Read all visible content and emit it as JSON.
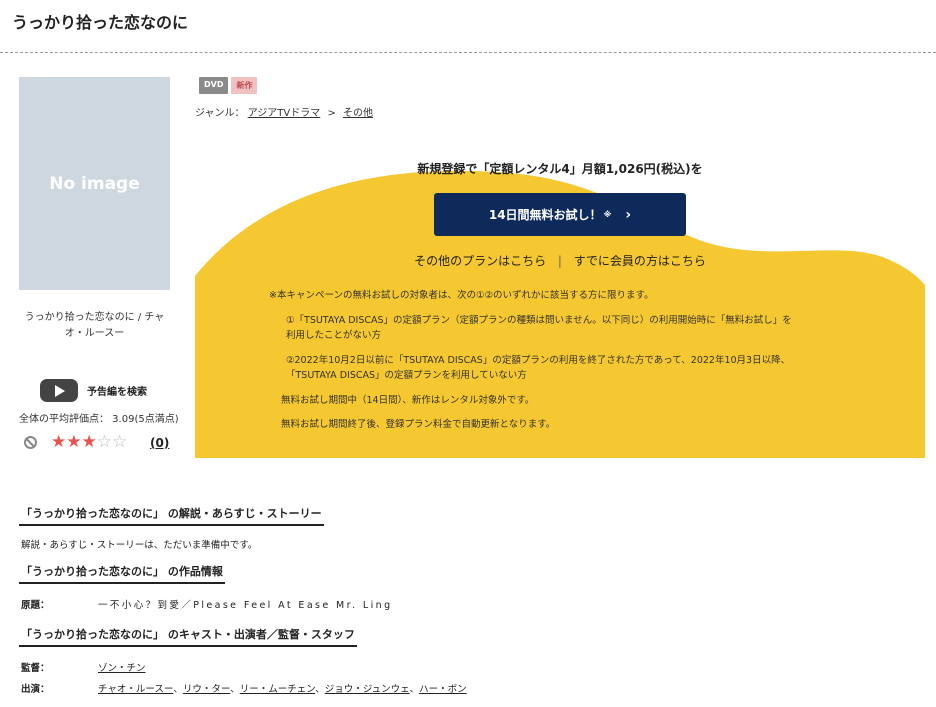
{
  "page": {
    "title": "うっかり拾った恋なのに"
  },
  "poster": {
    "placeholder": "No image",
    "caption": "うっかり拾った恋なのに / チャオ・ルースー"
  },
  "trailer": {
    "label": "予告編を検索"
  },
  "rating": {
    "average_text": "全体の平均評価点： 3.09(5点満点)",
    "stars_filled": 3,
    "stars_total": 5,
    "review_count": "(0)"
  },
  "badges": [
    "DVD",
    "新作"
  ],
  "genre": {
    "label": "ジャンル：",
    "items": [
      "アジアTVドラマ",
      "その他"
    ],
    "separator": ">"
  },
  "promo": {
    "headline": "新規登録で「定額レンタル4」月額1,026円(税込)を",
    "cta_label": "14日間無料お試し！",
    "cta_mark": "※",
    "cta_arrow": "›",
    "other_plans": "その他のプランはこちら",
    "separator": "|",
    "members": "すでに会員の方はこちら",
    "notes": [
      "※本キャンペーンの無料お試しの対象者は、次の①②のいずれかに該当する方に限ります。",
      "①「TSUTAYA DISCAS」の定額プラン（定額プランの種類は問いません。以下同じ）の利用開始時に「無料お試し」を",
      "利用したことがない方",
      "②2022年10月2日以前に「TSUTAYA DISCAS」の定額プランの利用を終了された方であって、2022年10月3日以降、",
      "「TSUTAYA DISCAS」の定額プランを利用していない方",
      "無料お試し期間中（14日間）、新作はレンタル対象外です。",
      "無料お試し期間終了後、登録プラン料金で自動更新となります。"
    ],
    "colors": {
      "yellow": "#f5c832",
      "cta_bg": "#0e2a5a"
    }
  },
  "synopsis": {
    "heading": "「うっかり拾った恋なのに」 の解説・あらすじ・ストーリー",
    "text": "解説・あらすじ・ストーリーは、ただいま準備中です。"
  },
  "work_info": {
    "heading": "「うっかり拾った恋なのに」 の作品情報",
    "original_title_label": "原題：",
    "original_title": "一不小心？到愛／Please Feel At Ease Mr. Ling"
  },
  "cast": {
    "heading": "「うっかり拾った恋なのに」 のキャスト・出演者／監督・スタッフ",
    "director_label": "監督：",
    "director": "ゾン・チン",
    "cast_label": "出演：",
    "cast_members": [
      "チャオ・ルースー",
      "リウ・ター",
      "リー・ムーチェン",
      "ジョウ・ジュンウェ",
      "ハー・ボン"
    ],
    "cast_separator": "、"
  }
}
